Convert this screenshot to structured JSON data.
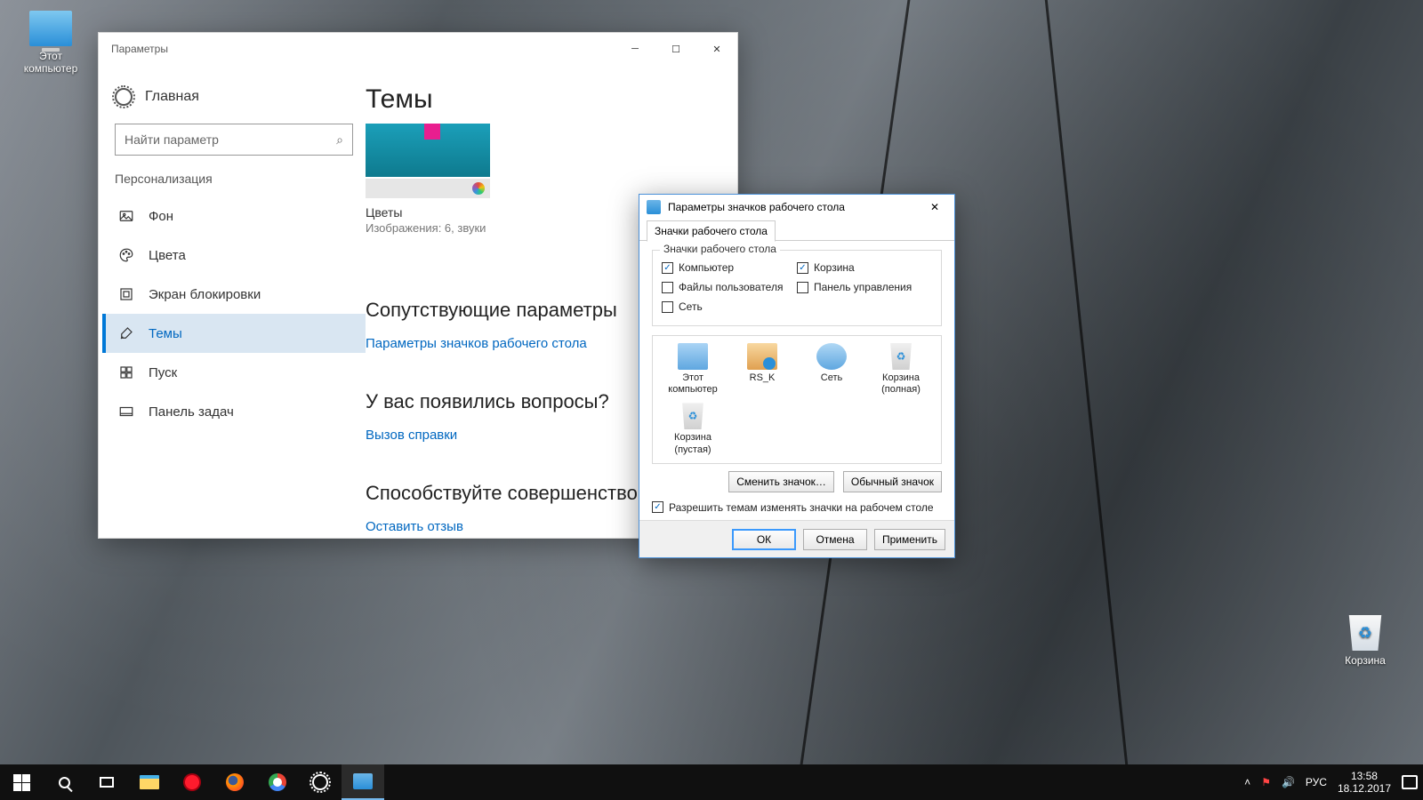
{
  "desktop": {
    "this_pc": "Этот\nкомпьютер",
    "recycle": "Корзина"
  },
  "settings": {
    "title": "Параметры",
    "home": "Главная",
    "search_placeholder": "Найти параметр",
    "section": "Персонализация",
    "nav": {
      "background": "Фон",
      "colors": "Цвета",
      "lockscreen": "Экран блокировки",
      "themes": "Темы",
      "start": "Пуск",
      "taskbar": "Панель задач"
    },
    "main": {
      "title": "Темы",
      "theme_name": "Цветы",
      "theme_sub": "Изображения: 6, звуки",
      "related_title": "Сопутствующие параметры",
      "related_link": "Параметры значков рабочего стола",
      "help_title": "У вас появились вопросы?",
      "help_link": "Вызов справки",
      "improve_title": "Способствуйте совершенствованию",
      "feedback_link": "Оставить отзыв"
    }
  },
  "dialog": {
    "title": "Параметры значков рабочего стола",
    "tab": "Значки рабочего стола",
    "group_title": "Значки рабочего стола",
    "cb": {
      "computer": "Компьютер",
      "bin": "Корзина",
      "userfiles": "Файлы пользователя",
      "cpanel": "Панель управления",
      "network": "Сеть"
    },
    "icons": {
      "thispc": "Этот\nкомпьютер",
      "user": "RS_K",
      "net": "Сеть",
      "bin_full": "Корзина\n(полная)",
      "bin_empty": "Корзина\n(пустая)"
    },
    "change_icon": "Сменить значок…",
    "default_icon": "Обычный значок",
    "allow_themes": "Разрешить темам изменять значки на рабочем столе",
    "ok": "ОК",
    "cancel": "Отмена",
    "apply": "Применить"
  },
  "taskbar": {
    "lang": "РУС",
    "time": "13:58",
    "date": "18.12.2017"
  }
}
